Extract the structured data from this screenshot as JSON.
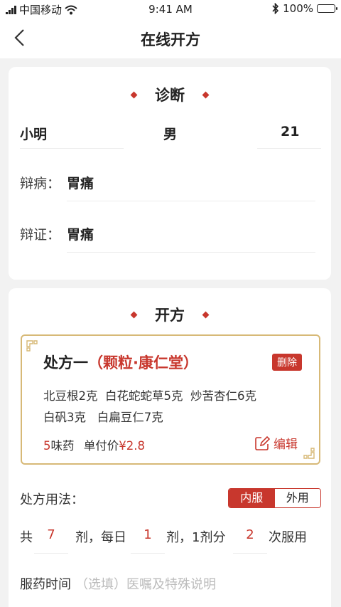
{
  "status": {
    "carrier": "中国移动",
    "time": "9:41 AM",
    "battery": "100%",
    "battery_level": 1.0
  },
  "nav": {
    "title": "在线开方"
  },
  "diagnosis": {
    "section_title": "诊断",
    "patient_name": "小明",
    "patient_gender": "男",
    "patient_age": "21",
    "disease_label": "辩病：",
    "disease_value": "胃痛",
    "syndrome_label": "辩证：",
    "syndrome_value": "胃痛"
  },
  "prescribe": {
    "section_title": "开方",
    "rx": {
      "title": "处方一",
      "subtitle": "（颗粒·康仁堂）",
      "delete_label": "删除",
      "herbs_line1": "北豆根2克  白花蛇蛇草5克  炒苦杏仁6克",
      "herbs_line2": "白矾3克   白扁豆仁7克",
      "count_num": "5",
      "count_unit": "味药",
      "price_label": "单付价",
      "price_value": "¥2.8",
      "edit_label": "编辑"
    },
    "usage": {
      "label": "处方用法：",
      "options": [
        "内服",
        "外用"
      ],
      "selected": "内服"
    },
    "dosage": {
      "prefix": "共",
      "total": "7",
      "unit_daily": "剂，每日",
      "daily": "1",
      "unit_split": "剂，1剂分",
      "split": "2",
      "suffix": "次服用"
    },
    "time_label": "服药时间",
    "time_placeholder": "（选填）医嘱及特殊说明"
  },
  "colors": {
    "accent": "#c8372d",
    "frame": "#d7b977"
  }
}
